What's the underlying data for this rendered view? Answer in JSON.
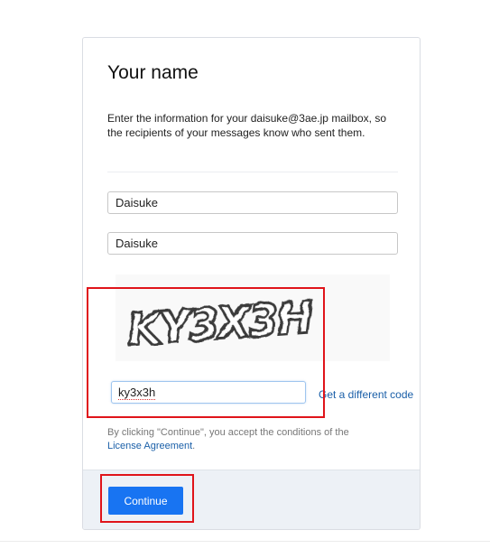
{
  "form": {
    "title": "Your name",
    "description": "Enter the information for your daisuke@3ae.jp mailbox, so the recipients of your messages know who sent them.",
    "first_name_value": "Daisuke",
    "last_name_value": "Daisuke"
  },
  "captcha": {
    "image_text": "ky3x3h",
    "input_value": "ky3x3h",
    "different_code_label": "Get a different code"
  },
  "agreement": {
    "text_before": "By clicking \"Continue\", you accept the conditions of the",
    "link_label": "License Agreement",
    "text_after": "."
  },
  "footer": {
    "continue_label": "Continue"
  },
  "colors": {
    "primary_button": "#1874f2",
    "link": "#1a5fa8",
    "highlight": "#e0141a",
    "footer_bg": "#edf1f6"
  }
}
